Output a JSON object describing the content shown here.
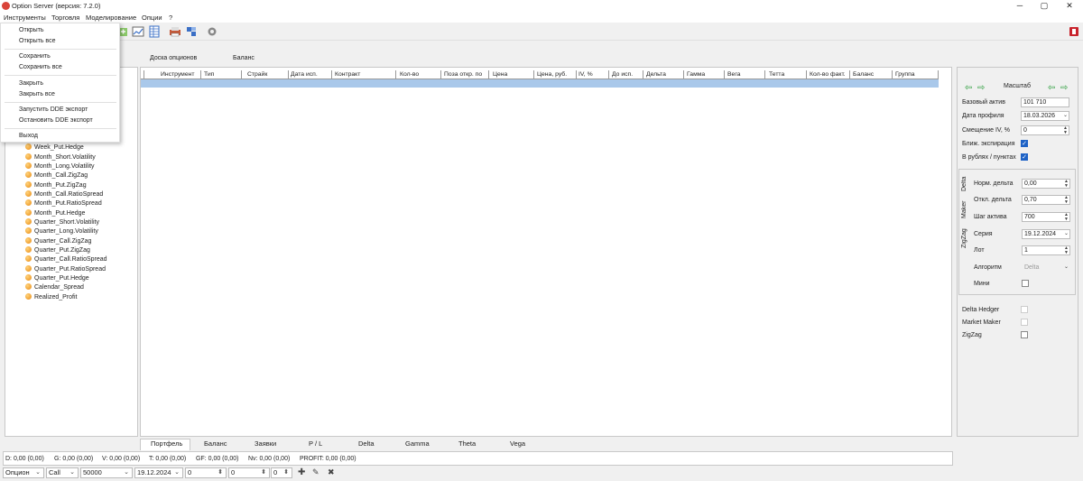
{
  "window": {
    "title": "Option Server (версия: 7.2.0)",
    "min": "─",
    "max": "▢",
    "close": "✕"
  },
  "menu": [
    "Инструменты",
    "Торговля",
    "Моделирование",
    "Опции",
    "?"
  ],
  "dropdown": {
    "items": [
      "Открыть",
      "Открыть все",
      "Сохранить",
      "Сохранить все",
      "Закрыть",
      "Закрыть все",
      "Запустить DDE экспорт",
      "Остановить DDE экспорт",
      "Выход"
    ]
  },
  "top_tabs": [
    "Доска опционов",
    "Баланс"
  ],
  "tree": {
    "items": [
      "Week_Put.Hedge",
      "Month_Short.Volatility",
      "Month_Long.Volatility",
      "Month_Call.ZigZag",
      "Month_Put.ZigZag",
      "Month_Call.RatioSpread",
      "Month_Put.RatioSpread",
      "Month_Put.Hedge",
      "Quarter_Short.Volatility",
      "Quarter_Long.Volatility",
      "Quarter_Call.ZigZag",
      "Quarter_Put.ZigZag",
      "Quarter_Call.RatioSpread",
      "Quarter_Put.RatioSpread",
      "Quarter_Put.Hedge",
      "Calendar_Spread",
      "Realized_Profit"
    ]
  },
  "grid": {
    "columns": [
      "Инструмент",
      "Тип",
      "Страйк",
      "Дата исп.",
      "Контракт",
      "Кол-во",
      "Поза откр. по",
      "Цена",
      "Цена, руб.",
      "IV, %",
      "До исп.",
      "Дельта",
      "Гамма",
      "Вега",
      "Тетта",
      "Кол-во факт.",
      "Баланс",
      "Группа"
    ]
  },
  "bottom_tabs": [
    "Портфель",
    "Баланс",
    "Заявки",
    "P / L",
    "Delta",
    "Gamma",
    "Theta",
    "Vega"
  ],
  "status": {
    "D": "D: 0,00  (0,00)",
    "G": "G: 0,00  (0,00)",
    "V": "V: 0,00  (0,00)",
    "T": "T: 0,00  (0,00)",
    "GF": "GF: 0,00  (0,00)",
    "Nv": "Nv: 0,00  (0,00)",
    "PROFIT": "PROFIT: 0,00  (0,00)"
  },
  "order_bar": {
    "instrument": "Опцион",
    "type": "Call",
    "strike": "50000",
    "date": "19.12.2024",
    "qty": "0",
    "price": "0",
    "qty2": "0"
  },
  "right_panel": {
    "scale_label": "Масштаб",
    "base_asset_label": "Базовый актив",
    "base_asset": "101 710",
    "profile_date_label": "Дата профиля",
    "profile_date": "18.03.2026",
    "iv_shift_label": "Смещение IV, %",
    "iv_shift": "0",
    "near_exp_label": "Ближ. экспирация",
    "rub_points_label": "В рублях / пунктах",
    "vtabs": [
      "Delta",
      "Maker",
      "ZigZag"
    ],
    "norm_delta_label": "Норм. дельта",
    "norm_delta": "0,00",
    "dev_delta_label": "Откл. дельта",
    "dev_delta": "0,70",
    "asset_step_label": "Шаг актива",
    "asset_step": "700",
    "series_label": "Серия",
    "series": "19.12.2024",
    "lot_label": "Лот",
    "lot": "1",
    "algo_label": "Алгоритм",
    "algo": "Delta",
    "mini_label": "Мини",
    "delta_hedger_label": "Delta Hedger",
    "market_maker_label": "Market Maker",
    "zigzag_label": "ZigZag"
  }
}
